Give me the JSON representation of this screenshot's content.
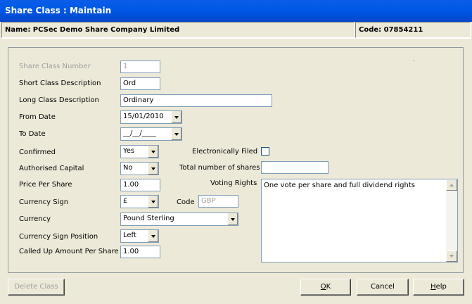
{
  "window": {
    "title": "Share Class : Maintain"
  },
  "header": {
    "name": "Name: PCSec Demo Share Company Limited",
    "code": "Code: 07854211"
  },
  "form": {
    "share_class_number_label": "Share Class Number",
    "share_class_number_value": "1",
    "short_desc_label": "Short Class Description",
    "short_desc_value": "Ord",
    "long_desc_label": "Long Class Description",
    "long_desc_value": "Ordinary",
    "from_date_label": "From Date",
    "from_date_value": "15/01/2010",
    "to_date_label": "To Date",
    "to_date_value": "__/__/____",
    "confirmed_label": "Confirmed",
    "confirmed_value": "Yes",
    "authorised_capital_label": "Authorised Capital",
    "authorised_capital_value": "No",
    "price_per_share_label": "Price Per Share",
    "price_per_share_value": "1.00",
    "currency_sign_label": "Currency Sign",
    "currency_sign_value": "£",
    "code_label": "Code",
    "code_value": "GBP",
    "currency_label": "Currency",
    "currency_value": "Pound Sterling",
    "currency_sign_position_label": "Currency Sign Position",
    "currency_sign_position_value": "Left",
    "called_up_label": "Called Up Amount Per Share",
    "called_up_value": "1.00",
    "electronically_filed_label": "Electronically Filed",
    "electronically_filed_checked": false,
    "total_shares_label": "Total number of shares",
    "total_shares_value": "",
    "voting_rights_label": "Voting Rights",
    "voting_rights_value": "One vote per share and full dividend rights"
  },
  "buttons": {
    "delete_class": "Delete Class",
    "ok_mnemonic": "O",
    "ok_rest": "K",
    "cancel": "Cancel",
    "help_mnemonic": "H",
    "help_rest": "elp"
  }
}
